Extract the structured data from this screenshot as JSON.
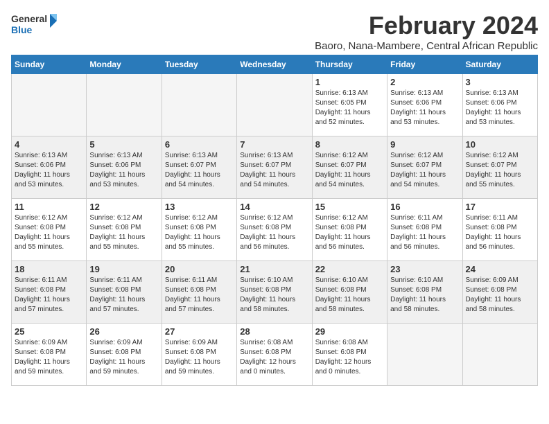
{
  "logo": {
    "line1": "General",
    "line2": "Blue"
  },
  "title": "February 2024",
  "subtitle": "Baoro, Nana-Mambere, Central African Republic",
  "weekdays": [
    "Sunday",
    "Monday",
    "Tuesday",
    "Wednesday",
    "Thursday",
    "Friday",
    "Saturday"
  ],
  "weeks": [
    [
      {
        "day": "",
        "info": ""
      },
      {
        "day": "",
        "info": ""
      },
      {
        "day": "",
        "info": ""
      },
      {
        "day": "",
        "info": ""
      },
      {
        "day": "1",
        "info": "Sunrise: 6:13 AM\nSunset: 6:05 PM\nDaylight: 11 hours\nand 52 minutes."
      },
      {
        "day": "2",
        "info": "Sunrise: 6:13 AM\nSunset: 6:06 PM\nDaylight: 11 hours\nand 53 minutes."
      },
      {
        "day": "3",
        "info": "Sunrise: 6:13 AM\nSunset: 6:06 PM\nDaylight: 11 hours\nand 53 minutes."
      }
    ],
    [
      {
        "day": "4",
        "info": "Sunrise: 6:13 AM\nSunset: 6:06 PM\nDaylight: 11 hours\nand 53 minutes."
      },
      {
        "day": "5",
        "info": "Sunrise: 6:13 AM\nSunset: 6:06 PM\nDaylight: 11 hours\nand 53 minutes."
      },
      {
        "day": "6",
        "info": "Sunrise: 6:13 AM\nSunset: 6:07 PM\nDaylight: 11 hours\nand 54 minutes."
      },
      {
        "day": "7",
        "info": "Sunrise: 6:13 AM\nSunset: 6:07 PM\nDaylight: 11 hours\nand 54 minutes."
      },
      {
        "day": "8",
        "info": "Sunrise: 6:12 AM\nSunset: 6:07 PM\nDaylight: 11 hours\nand 54 minutes."
      },
      {
        "day": "9",
        "info": "Sunrise: 6:12 AM\nSunset: 6:07 PM\nDaylight: 11 hours\nand 54 minutes."
      },
      {
        "day": "10",
        "info": "Sunrise: 6:12 AM\nSunset: 6:07 PM\nDaylight: 11 hours\nand 55 minutes."
      }
    ],
    [
      {
        "day": "11",
        "info": "Sunrise: 6:12 AM\nSunset: 6:08 PM\nDaylight: 11 hours\nand 55 minutes."
      },
      {
        "day": "12",
        "info": "Sunrise: 6:12 AM\nSunset: 6:08 PM\nDaylight: 11 hours\nand 55 minutes."
      },
      {
        "day": "13",
        "info": "Sunrise: 6:12 AM\nSunset: 6:08 PM\nDaylight: 11 hours\nand 55 minutes."
      },
      {
        "day": "14",
        "info": "Sunrise: 6:12 AM\nSunset: 6:08 PM\nDaylight: 11 hours\nand 56 minutes."
      },
      {
        "day": "15",
        "info": "Sunrise: 6:12 AM\nSunset: 6:08 PM\nDaylight: 11 hours\nand 56 minutes."
      },
      {
        "day": "16",
        "info": "Sunrise: 6:11 AM\nSunset: 6:08 PM\nDaylight: 11 hours\nand 56 minutes."
      },
      {
        "day": "17",
        "info": "Sunrise: 6:11 AM\nSunset: 6:08 PM\nDaylight: 11 hours\nand 56 minutes."
      }
    ],
    [
      {
        "day": "18",
        "info": "Sunrise: 6:11 AM\nSunset: 6:08 PM\nDaylight: 11 hours\nand 57 minutes."
      },
      {
        "day": "19",
        "info": "Sunrise: 6:11 AM\nSunset: 6:08 PM\nDaylight: 11 hours\nand 57 minutes."
      },
      {
        "day": "20",
        "info": "Sunrise: 6:11 AM\nSunset: 6:08 PM\nDaylight: 11 hours\nand 57 minutes."
      },
      {
        "day": "21",
        "info": "Sunrise: 6:10 AM\nSunset: 6:08 PM\nDaylight: 11 hours\nand 58 minutes."
      },
      {
        "day": "22",
        "info": "Sunrise: 6:10 AM\nSunset: 6:08 PM\nDaylight: 11 hours\nand 58 minutes."
      },
      {
        "day": "23",
        "info": "Sunrise: 6:10 AM\nSunset: 6:08 PM\nDaylight: 11 hours\nand 58 minutes."
      },
      {
        "day": "24",
        "info": "Sunrise: 6:09 AM\nSunset: 6:08 PM\nDaylight: 11 hours\nand 58 minutes."
      }
    ],
    [
      {
        "day": "25",
        "info": "Sunrise: 6:09 AM\nSunset: 6:08 PM\nDaylight: 11 hours\nand 59 minutes."
      },
      {
        "day": "26",
        "info": "Sunrise: 6:09 AM\nSunset: 6:08 PM\nDaylight: 11 hours\nand 59 minutes."
      },
      {
        "day": "27",
        "info": "Sunrise: 6:09 AM\nSunset: 6:08 PM\nDaylight: 11 hours\nand 59 minutes."
      },
      {
        "day": "28",
        "info": "Sunrise: 6:08 AM\nSunset: 6:08 PM\nDaylight: 12 hours\nand 0 minutes."
      },
      {
        "day": "29",
        "info": "Sunrise: 6:08 AM\nSunset: 6:08 PM\nDaylight: 12 hours\nand 0 minutes."
      },
      {
        "day": "",
        "info": ""
      },
      {
        "day": "",
        "info": ""
      }
    ]
  ]
}
